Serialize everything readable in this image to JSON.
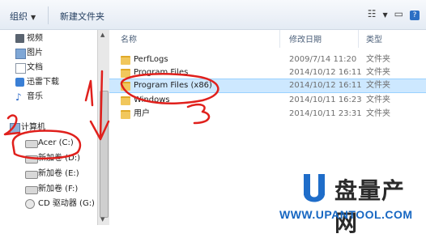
{
  "toolbar": {
    "organize": "组织",
    "new_folder": "新建文件夹"
  },
  "nav": {
    "libraries": [
      {
        "label": "视频",
        "icon": "video-icon"
      },
      {
        "label": "图片",
        "icon": "picture-icon"
      },
      {
        "label": "文档",
        "icon": "document-icon"
      },
      {
        "label": "迅雷下载",
        "icon": "thunder-download-icon"
      },
      {
        "label": "音乐",
        "icon": "music-icon"
      }
    ],
    "computer": "计算机",
    "drives": [
      {
        "label": "Acer (C:)"
      },
      {
        "label": "新加卷 (D:)"
      },
      {
        "label": "新加卷 (E:)"
      },
      {
        "label": "新加卷 (F:)"
      },
      {
        "label": "CD 驱动器 (G:)"
      }
    ]
  },
  "columns": {
    "name": "名称",
    "date": "修改日期",
    "type": "类型"
  },
  "files": [
    {
      "name": "PerfLogs",
      "date": "2009/7/14 11:20",
      "type": "文件夹"
    },
    {
      "name": "Program Files",
      "date": "2014/10/12 16:11",
      "type": "文件夹"
    },
    {
      "name": "Program Files (x86)",
      "date": "2014/10/12 16:11",
      "type": "文件夹",
      "selected": true
    },
    {
      "name": "Windows",
      "date": "2014/10/11 16:23",
      "type": "文件夹"
    },
    {
      "name": "用户",
      "date": "2014/10/11 23:31",
      "type": "文件夹"
    }
  ],
  "annotations": [
    "1",
    "2",
    "3"
  ],
  "watermark": {
    "brand": "盘量产网",
    "url": "WWW.UPANTOOL.COM"
  },
  "colors": {
    "selection": "#cde8ff",
    "annotation": "#e0201c",
    "folder": "#f1c75c",
    "brand_blue": "#1767c2"
  }
}
